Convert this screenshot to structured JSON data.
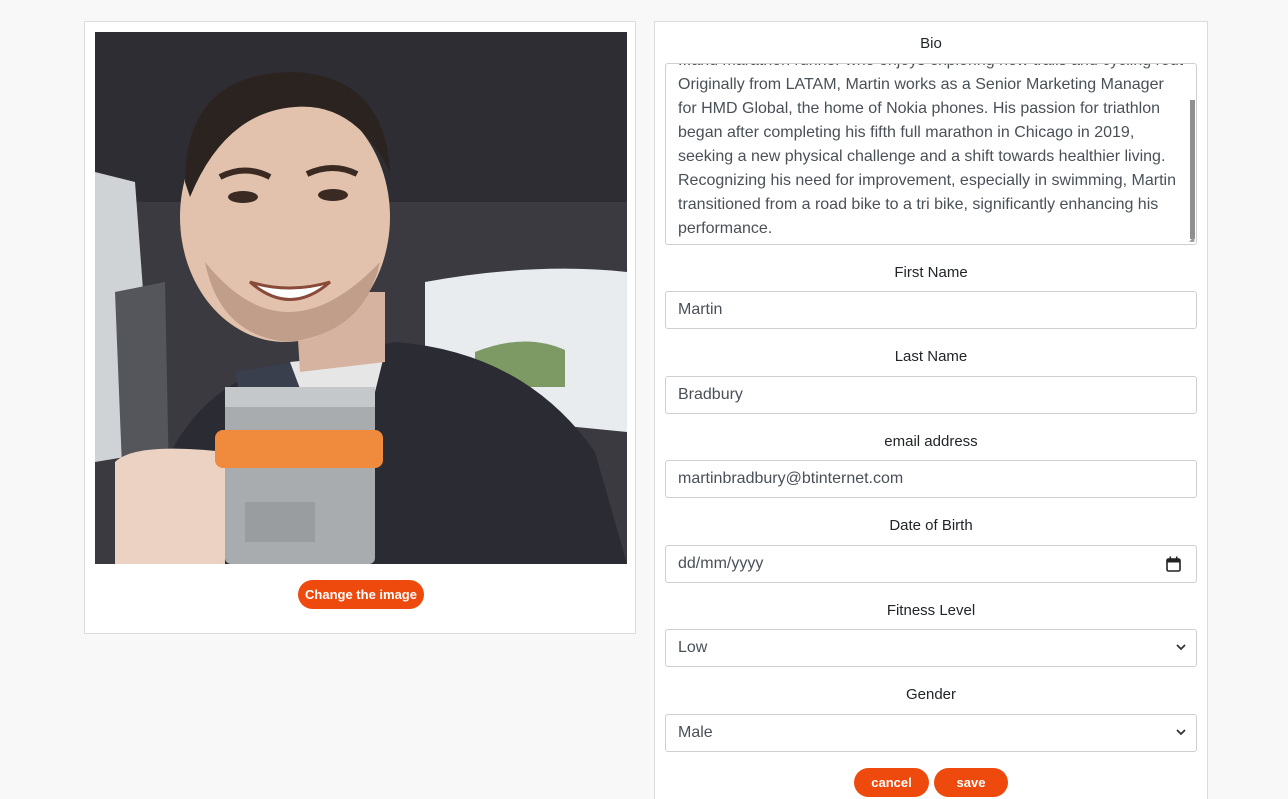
{
  "photo_card": {
    "change_image_label": "Change the image"
  },
  "form": {
    "bio": {
      "label": "Bio",
      "cut_line": "...and marathon runner who enjoys exploring new trails and cycling routes nearby.",
      "value": "Originally from LATAM, Martin works as a Senior Marketing Manager for HMD Global, the home of Nokia phones. His passion for triathlon began after completing his fifth full marathon in Chicago in 2019, seeking a new physical challenge and a shift towards healthier living. Recognizing his need for improvement, especially in swimming, Martin transitioned from a road bike to a tri bike, significantly enhancing his performance."
    },
    "first_name": {
      "label": "First Name",
      "value": "Martin"
    },
    "last_name": {
      "label": "Last Name",
      "value": "Bradbury"
    },
    "email": {
      "label": "email address",
      "value": "martinbradbury@btinternet.com"
    },
    "dob": {
      "label": "Date of Birth",
      "placeholder": "dd/mm/yyyy",
      "icon": "calendar-icon"
    },
    "fitness_level": {
      "label": "Fitness Level",
      "selected": "Low",
      "icon": "chevron-down-icon"
    },
    "gender": {
      "label": "Gender",
      "selected": "Male",
      "icon": "chevron-down-icon"
    },
    "cancel_label": "cancel",
    "save_label": "save"
  },
  "colors": {
    "accent": "#ee4a0e",
    "page_background": "#f8f8f8",
    "card_border": "#dcdcdc"
  }
}
